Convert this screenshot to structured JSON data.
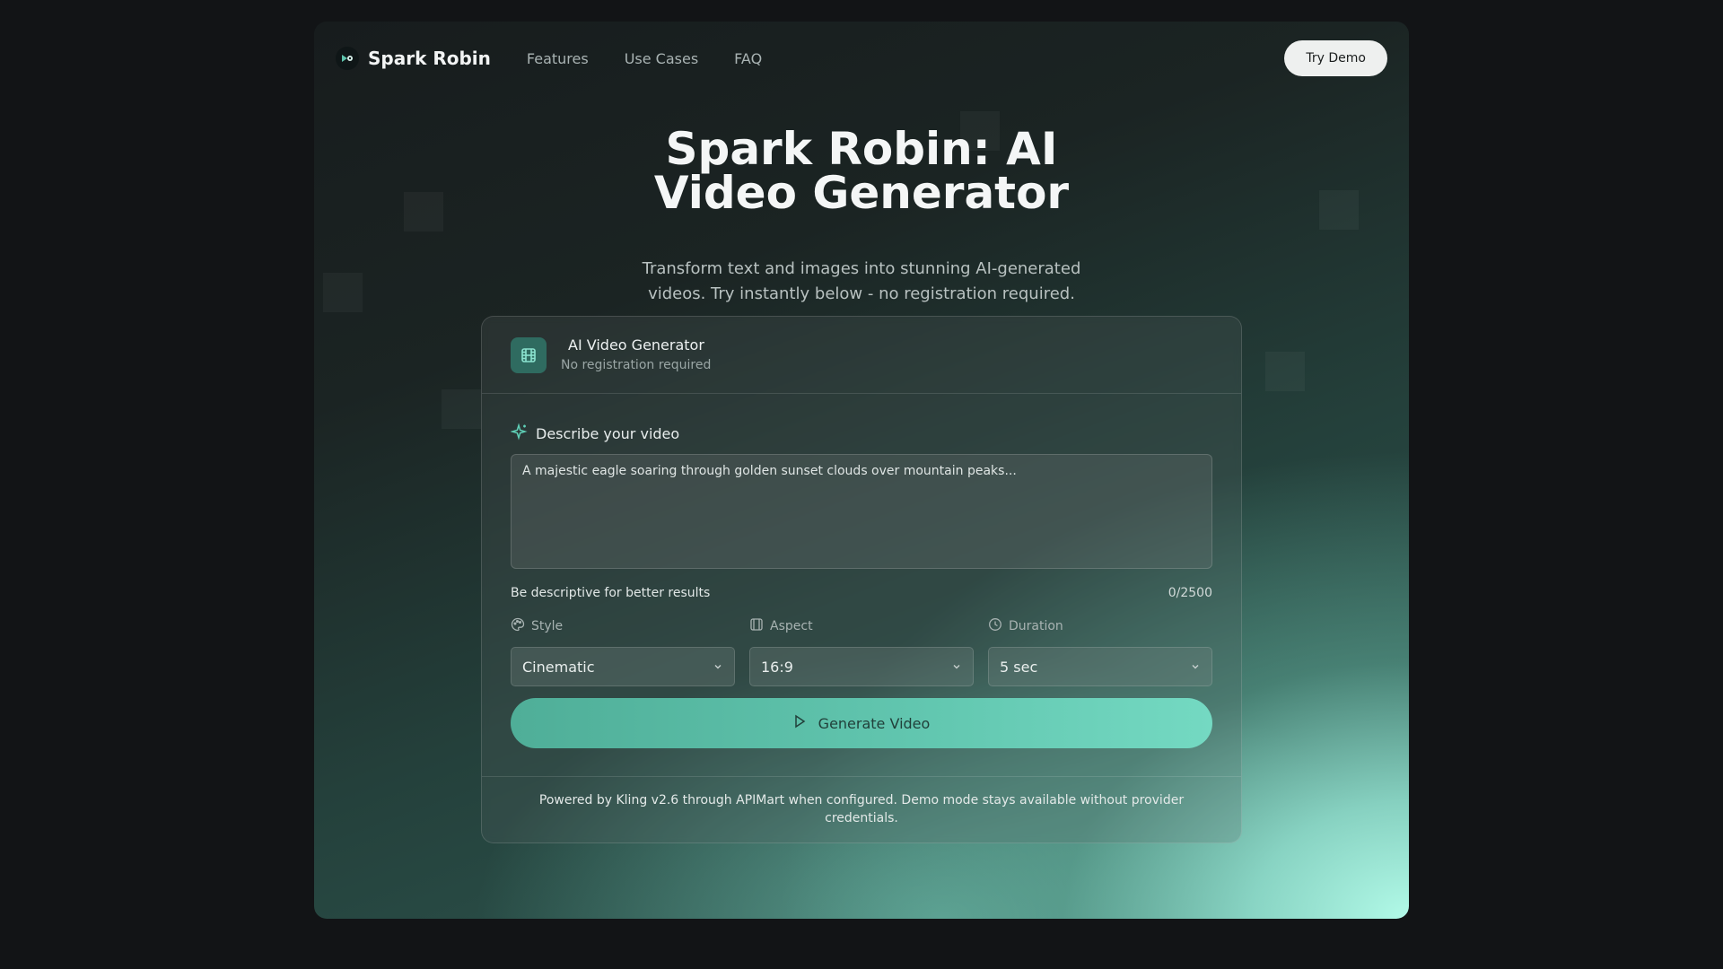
{
  "nav": {
    "brand": "Spark Robin",
    "links": [
      "Features",
      "Use Cases",
      "FAQ"
    ],
    "cta": "Try Demo"
  },
  "hero": {
    "title_line1": "Spark Robin: AI",
    "title_line2": "Video Generator",
    "subtitle_line1": "Transform text and images into stunning AI-generated",
    "subtitle_line2": "videos. Try instantly below - no registration required."
  },
  "card": {
    "title": "AI Video Generator",
    "subtitle": "No registration required",
    "prompt_label": "Describe your video",
    "prompt_placeholder": "A majestic eagle soaring through golden sunset clouds over mountain peaks...",
    "hint": "Be descriptive for better results",
    "counter": "0/2500",
    "style_label": "Style",
    "style_value": "Cinematic",
    "aspect_label": "Aspect",
    "aspect_value": "16:9",
    "duration_label": "Duration",
    "duration_value": "5 sec",
    "generate_label": "Generate Video",
    "footer_line1": "Powered by Kling v2.6 through APIMart when configured. Demo mode stays available without provider",
    "footer_line2": "credentials."
  },
  "colors": {
    "accent": "#5fc4ad",
    "background": "#121416"
  },
  "icons": [
    "logo-icon",
    "film-icon",
    "sparkle-icon",
    "palette-icon",
    "aspect-icon",
    "clock-icon",
    "chevron-down-icon",
    "play-icon"
  ]
}
